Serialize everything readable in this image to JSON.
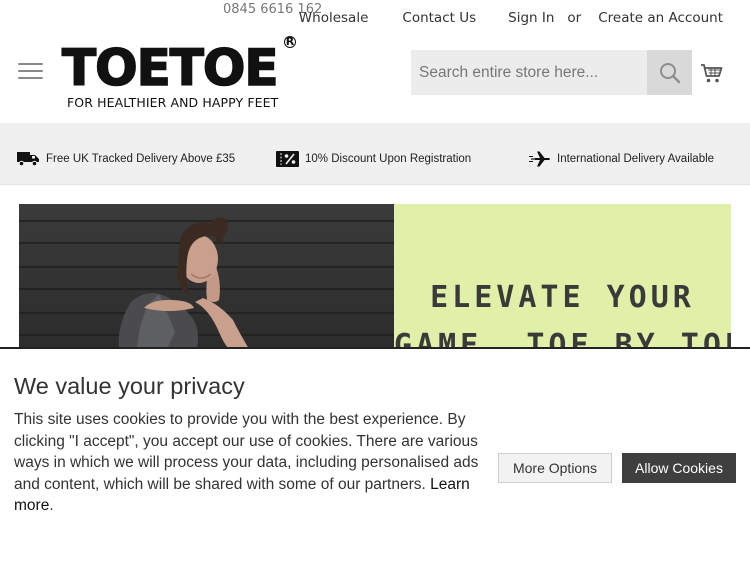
{
  "topbar": {
    "phone": "0845 6616 162",
    "links": {
      "wholesale": "Wholesale",
      "contact": "Contact Us",
      "signin": "Sign In",
      "or": "or",
      "create": "Create an Account"
    }
  },
  "header": {
    "logo_text": "TOETOE",
    "logo_reg": "R",
    "tagline": "FOR HEALTHIER AND HAPPY FEET",
    "search": {
      "placeholder": "Search entire store here...",
      "value": ""
    },
    "icons": {
      "menu": "hamburger-menu-icon",
      "search": "search-icon",
      "cart": "cart-icon"
    }
  },
  "usp": [
    {
      "icon": "delivery-truck-icon",
      "label": "Free UK Tracked Delivery Above £35"
    },
    {
      "icon": "discount-tag-icon",
      "label": "10% Discount Upon Registration"
    },
    {
      "icon": "airplane-icon",
      "label": "International Delivery Available"
    }
  ],
  "hero": {
    "line1": "ELEVATE YOUR",
    "line2": "GAME, TOE BY TOE",
    "panel_color": "#e0f0a8"
  },
  "cookie": {
    "title": "We value your privacy",
    "body": "This site uses cookies to provide you with the best experience. By clicking \"I accept\", you accept our use of cookies. There are various ways in which we will process your data, including personalised ads and content, which will be shared with some of our partners. ",
    "learn_more": "Learn more",
    "period": ".",
    "more_options": "More Options",
    "allow": "Allow Cookies"
  }
}
